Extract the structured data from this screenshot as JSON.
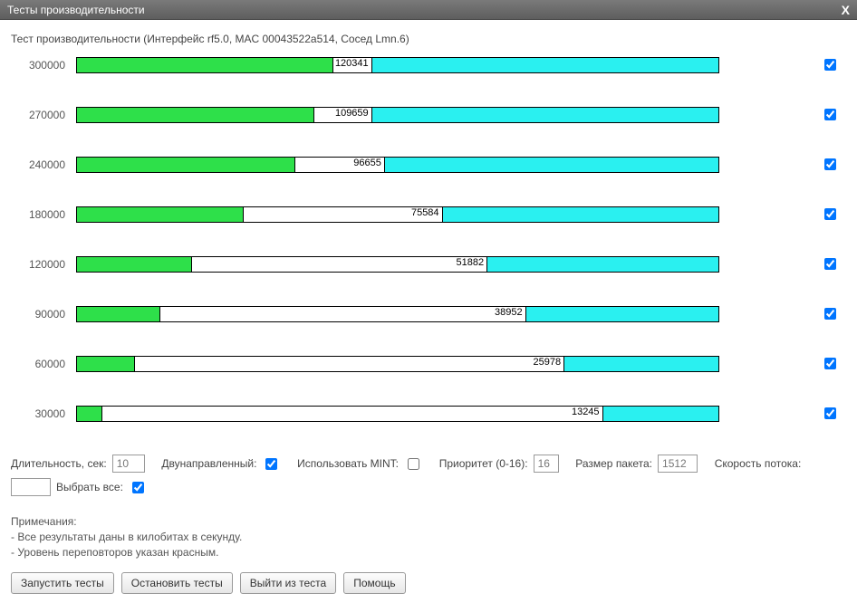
{
  "titlebar": {
    "title": "Тесты производительности",
    "close": "X"
  },
  "subtitle": "Тест производительности (Интерфейс rf5.0, MAC 00043522a514, Сосед Lmn.6)",
  "rows": [
    {
      "label": "300000",
      "green_val": "120737",
      "cyan_val": "120341",
      "green_pct": 40,
      "white_pct": 6,
      "cyan_pct": 54,
      "checked": true
    },
    {
      "label": "270000",
      "green_val": "110463",
      "cyan_val": "109659",
      "green_pct": 37,
      "white_pct": 9,
      "cyan_pct": 54,
      "checked": true
    },
    {
      "label": "240000",
      "green_val": "100190",
      "cyan_val": "96655",
      "green_pct": 34,
      "white_pct": 14,
      "cyan_pct": 52,
      "checked": true
    },
    {
      "label": "180000",
      "green_val": "77432",
      "cyan_val": "75584",
      "green_pct": 26,
      "white_pct": 31,
      "cyan_pct": 43,
      "checked": true
    },
    {
      "label": "120000",
      "green_val": "54140",
      "cyan_val": "51882",
      "green_pct": 18,
      "white_pct": 46,
      "cyan_pct": 36,
      "checked": true
    },
    {
      "label": "90000",
      "green_val": "40541",
      "cyan_val": "38952",
      "green_pct": 13,
      "white_pct": 57,
      "cyan_pct": 30,
      "checked": true
    },
    {
      "label": "60000",
      "green_val": "27270",
      "cyan_val": "25978",
      "green_pct": 9,
      "white_pct": 67,
      "cyan_pct": 24,
      "checked": true
    },
    {
      "label": "30000",
      "green_val": "13691",
      "cyan_val": "13245",
      "green_pct": 4,
      "white_pct": 78,
      "cyan_pct": 18,
      "checked": true
    }
  ],
  "controls": {
    "duration_label": "Длительность, сек:",
    "duration_value": "10",
    "bidir_label": "Двунаправленный:",
    "bidir_checked": true,
    "mint_label": "Использовать MINT:",
    "mint_checked": false,
    "priority_label": "Приоритет (0-16):",
    "priority_value": "16",
    "packet_label": "Размер пакета:",
    "packet_value": "1512",
    "rate_label": "Скорость потока:",
    "rate_value": "",
    "selectall_label": "Выбрать все:",
    "selectall_checked": true
  },
  "notes": {
    "heading": "Примечания:",
    "line1": "- Все результаты даны в килобитах в секунду.",
    "line2": "- Уровень переповторов указан красным."
  },
  "buttons": {
    "run": "Запустить тесты",
    "stop": "Остановить тесты",
    "exit": "Выйти из теста",
    "help": "Помощь"
  }
}
